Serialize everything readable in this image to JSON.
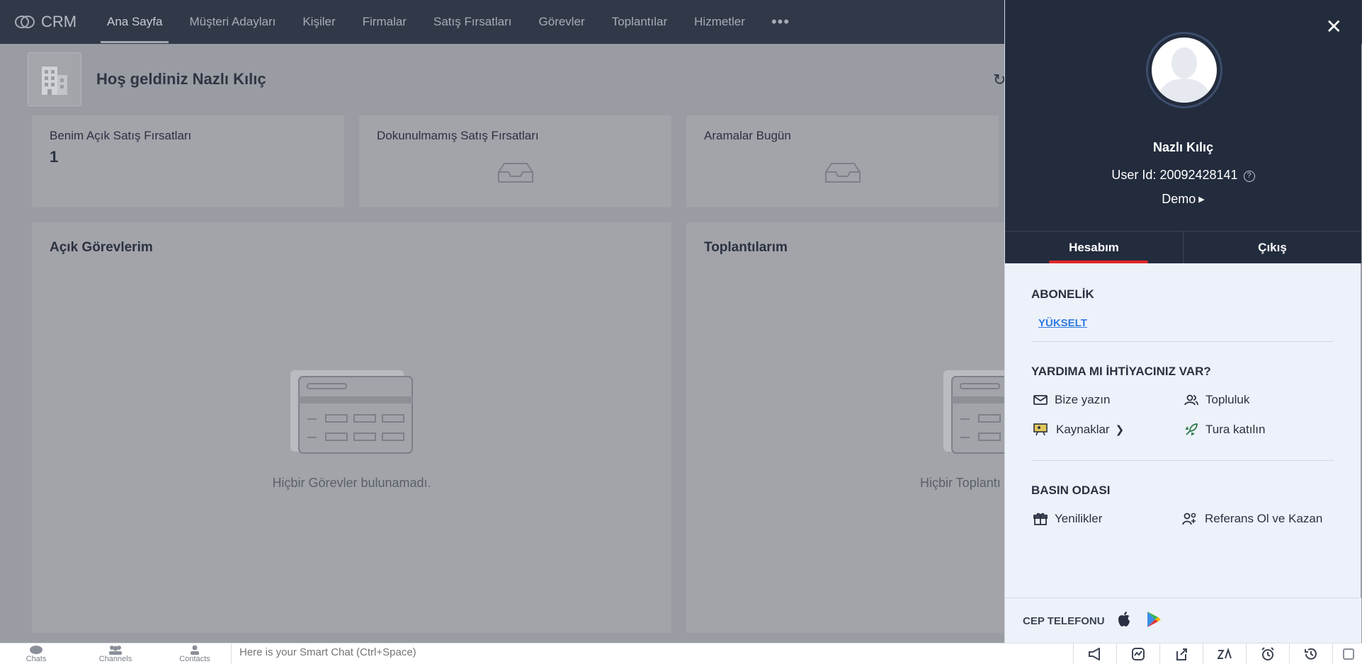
{
  "app": {
    "brand": "CRM"
  },
  "nav": {
    "tabs": [
      {
        "label": "Ana Sayfa",
        "active": true
      },
      {
        "label": "Müşteri Adayları"
      },
      {
        "label": "Kişiler"
      },
      {
        "label": "Firmalar"
      },
      {
        "label": "Satış Fırsatları"
      },
      {
        "label": "Görevler"
      },
      {
        "label": "Toplantılar"
      },
      {
        "label": "Hizmetler"
      }
    ],
    "more": "•••"
  },
  "dashboard": {
    "welcome": "Hoş geldiniz Nazlı Kılıç",
    "stat_cards": [
      {
        "title": "Benim Açık Satış Fırsatları",
        "value": "1"
      },
      {
        "title": "Dokunulmamış Satış Fırsatları"
      },
      {
        "title": "Aramalar Bugün"
      }
    ],
    "panels": [
      {
        "title": "Açık Görevlerim",
        "empty_text": "Hiçbir Görevler bulunamadı."
      },
      {
        "title": "Toplantılarım",
        "empty_text": "Hiçbir Toplantı"
      }
    ]
  },
  "profile": {
    "name": "Nazlı Kılıç",
    "user_id": "User Id: 20092428141",
    "org": "Demo",
    "tabs": {
      "account": "Hesabım",
      "logout": "Çıkış"
    },
    "subscription": {
      "title": "ABONELİK",
      "upgrade": "YÜKSELT"
    },
    "help": {
      "title": "YARDIMA MI İHTİYACINIZ VAR?",
      "write_us": "Bize yazın",
      "community": "Topluluk",
      "resources": "Kaynaklar",
      "tour": "Tura katılın"
    },
    "press": {
      "title": "BASIN ODASI",
      "whats_new": "Yenilikler",
      "referral": "Referans Ol ve Kazan"
    },
    "mobile": {
      "title": "CEP TELEFONU"
    }
  },
  "bottombar": {
    "chats": "Chats",
    "channels": "Channels",
    "contacts": "Contacts",
    "smart_chat_placeholder": "Here is your Smart Chat (Ctrl+Space)"
  },
  "colors": {
    "nav_bg": "#313949",
    "panel_head_bg": "#222c3d",
    "accent_red": "#e42527",
    "link_blue": "#2e7ce0"
  }
}
